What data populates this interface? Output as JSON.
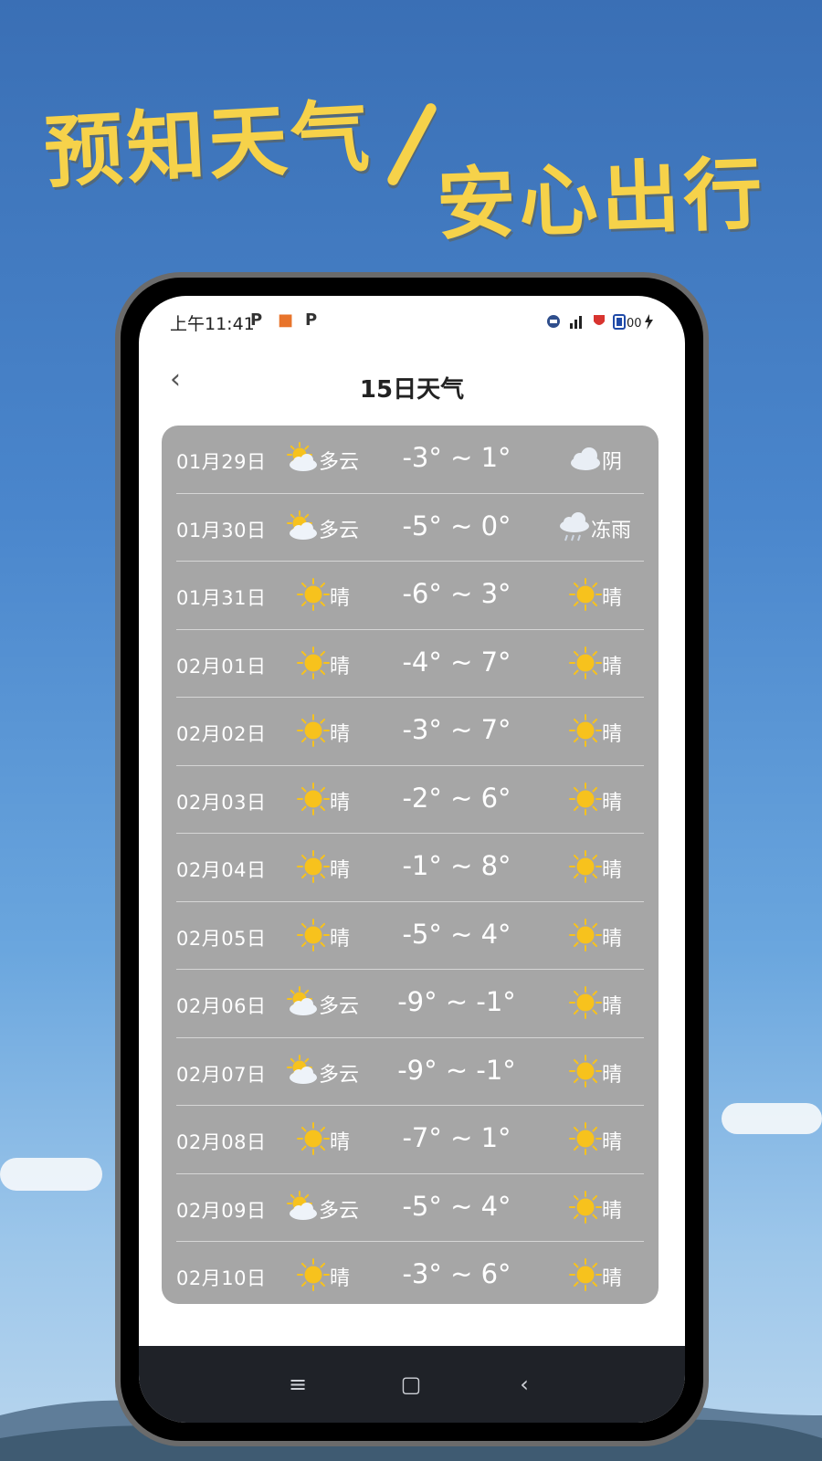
{
  "slogan": {
    "line1": "预知天气",
    "line2": "安心出行"
  },
  "status": {
    "time": "上午11:41",
    "app_icons": [
      "P",
      "■",
      "P"
    ],
    "battery_text": "00"
  },
  "header": {
    "title": "15日天气",
    "back_label": "‹"
  },
  "forecast": [
    {
      "date": "01月29日",
      "day": "多云",
      "day_icon": "partly-cloudy",
      "temp": "-3° ~ 1°",
      "night": "阴",
      "night_icon": "overcast"
    },
    {
      "date": "01月30日",
      "day": "多云",
      "day_icon": "partly-cloudy",
      "temp": "-5° ~ 0°",
      "night": "冻雨",
      "night_icon": "freezing-rain"
    },
    {
      "date": "01月31日",
      "day": "晴",
      "day_icon": "sunny",
      "temp": "-6° ~ 3°",
      "night": "晴",
      "night_icon": "sunny"
    },
    {
      "date": "02月01日",
      "day": "晴",
      "day_icon": "sunny",
      "temp": "-4° ~ 7°",
      "night": "晴",
      "night_icon": "sunny"
    },
    {
      "date": "02月02日",
      "day": "晴",
      "day_icon": "sunny",
      "temp": "-3° ~ 7°",
      "night": "晴",
      "night_icon": "sunny"
    },
    {
      "date": "02月03日",
      "day": "晴",
      "day_icon": "sunny",
      "temp": "-2° ~ 6°",
      "night": "晴",
      "night_icon": "sunny"
    },
    {
      "date": "02月04日",
      "day": "晴",
      "day_icon": "sunny",
      "temp": "-1° ~ 8°",
      "night": "晴",
      "night_icon": "sunny"
    },
    {
      "date": "02月05日",
      "day": "晴",
      "day_icon": "sunny",
      "temp": "-5° ~ 4°",
      "night": "晴",
      "night_icon": "sunny"
    },
    {
      "date": "02月06日",
      "day": "多云",
      "day_icon": "partly-cloudy",
      "temp": "-9° ~ -1°",
      "night": "晴",
      "night_icon": "sunny"
    },
    {
      "date": "02月07日",
      "day": "多云",
      "day_icon": "partly-cloudy",
      "temp": "-9° ~ -1°",
      "night": "晴",
      "night_icon": "sunny"
    },
    {
      "date": "02月08日",
      "day": "晴",
      "day_icon": "sunny",
      "temp": "-7° ~ 1°",
      "night": "晴",
      "night_icon": "sunny"
    },
    {
      "date": "02月09日",
      "day": "多云",
      "day_icon": "partly-cloudy",
      "temp": "-5° ~ 4°",
      "night": "晴",
      "night_icon": "sunny"
    },
    {
      "date": "02月10日",
      "day": "晴",
      "day_icon": "sunny",
      "temp": "-3° ~ 6°",
      "night": "晴",
      "night_icon": "sunny"
    }
  ],
  "sysnav": {
    "menu": "≡",
    "home": "▢",
    "back": "‹"
  },
  "colors": {
    "slogan": "#f6d24a",
    "card": "#a6a6a6",
    "sun": "#f7c21d",
    "sysnav": "#1f2228"
  }
}
